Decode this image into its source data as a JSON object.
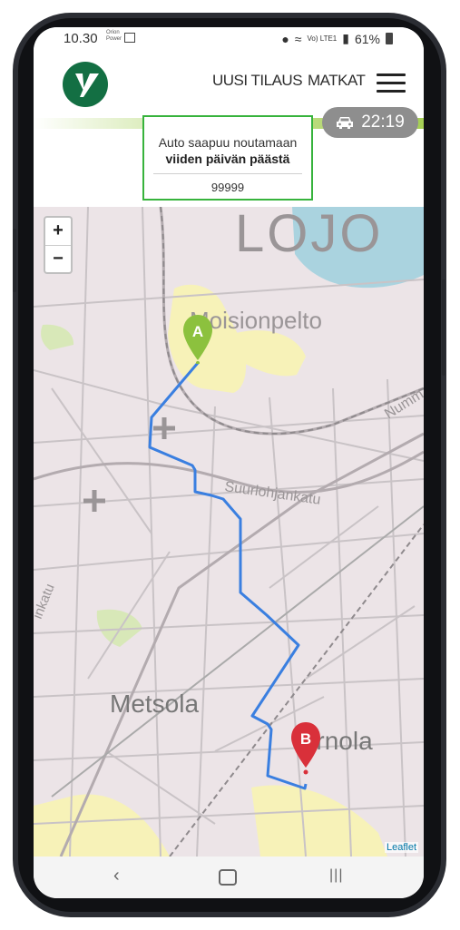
{
  "status_bar": {
    "time": "10.30",
    "carrier_small": "Orion\nPower",
    "network": "Vo) LTE1",
    "battery": "61%"
  },
  "header": {
    "nav": [
      "UUSI TILAUS",
      "MATKAT"
    ]
  },
  "eta": {
    "time": "22:19"
  },
  "info": {
    "line1": "Auto saapuu noutamaan",
    "line2": "viiden päivän päästä",
    "code": "99999"
  },
  "map": {
    "place_labels": [
      "LOJO",
      "Moisionpelto",
      "Suurlohjankatu",
      "Metsola",
      "Virnola",
      "Numm",
      "inkatu"
    ],
    "markers": {
      "start": "A",
      "end": "B"
    },
    "zoom_in": "+",
    "zoom_out": "−",
    "attribution": "Leaflet"
  },
  "colors": {
    "accent_green": "#37b33c",
    "brand_green": "#136f43",
    "route_blue": "#3a7fe0",
    "marker_green": "#8cc13e",
    "marker_red": "#d9303a"
  }
}
